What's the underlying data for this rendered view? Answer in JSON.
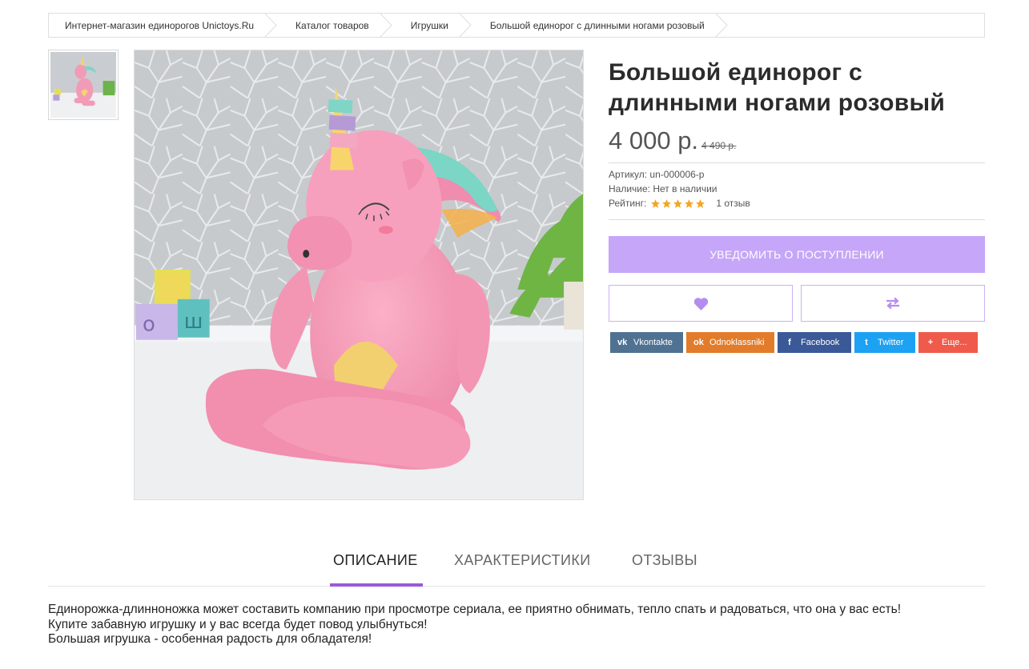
{
  "breadcrumb": [
    "Интернет-магазин единорогов Unictoys.Ru",
    "Каталог товаров",
    "Игрушки",
    "Большой единорог с длинными ногами розовый"
  ],
  "product": {
    "title": "Большой единорог с длинными ногами розовый",
    "price": "4 000 р.",
    "old_price": "4 490 р.",
    "sku_label": "Артикул:",
    "sku": "un-000006-p",
    "availability_label": "Наличие:",
    "availability": "Нет в наличии",
    "rating_label": "Рейтинг:",
    "rating": 5,
    "rating_max": 5,
    "reviews_count": "1 отзыв"
  },
  "actions": {
    "notify": "УВЕДОМИТЬ О ПОСТУПЛЕНИИ",
    "wishlist_icon": "heart-icon",
    "compare_icon": "compare-arrows-icon"
  },
  "share": [
    {
      "label": "Vkontakte",
      "icon": "vk-icon",
      "glyph": "vk",
      "color": "#4f7293"
    },
    {
      "label": "Odnoklassniki",
      "icon": "odnoklassniki-icon",
      "glyph": "ok",
      "color": "#e27c2a"
    },
    {
      "label": "Facebook",
      "icon": "facebook-icon",
      "glyph": "f",
      "color": "#3b5998"
    },
    {
      "label": "Twitter",
      "icon": "twitter-icon",
      "glyph": "t",
      "color": "#1da1f2"
    },
    {
      "label": "Еще...",
      "icon": "plus-icon",
      "glyph": "+",
      "color": "#f05a4a"
    }
  ],
  "tabs": [
    {
      "label": "ОПИСАНИЕ",
      "active": true
    },
    {
      "label": "ХАРАКТЕРИСТИКИ",
      "active": false
    },
    {
      "label": "ОТЗЫВЫ",
      "active": false
    }
  ],
  "description": [
    "Единорожка-длинноножка может составить компанию при просмотре сериала, ее приятно обнимать, тепло спать и радоваться, что она у вас есть!",
    "Купите забавную игрушку и у вас всегда будет повод улыбнуться!",
    "Большая игрушка - особенная радость для обладателя!"
  ],
  "colors": {
    "accent": "#c5a6f8",
    "tab_underline": "#9b59d6",
    "star": "#f5a623"
  }
}
